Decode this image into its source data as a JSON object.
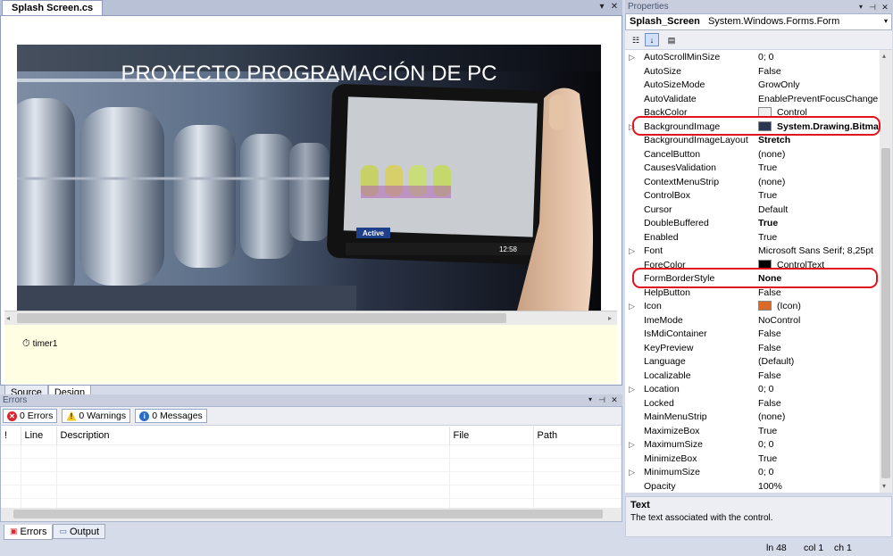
{
  "document_tab": {
    "title": "Splash Screen.cs"
  },
  "splash": {
    "title": "PROYECTO PROGRAMACIÓN DE PC",
    "tablet_status": "Active",
    "tablet_clock": "12:58"
  },
  "component_tray": {
    "timer": "timer1"
  },
  "designer_tabs": [
    "Source",
    "Design"
  ],
  "errors": {
    "title": "Errors",
    "errors_btn": "0 Errors",
    "warnings_btn": "0 Warnings",
    "messages_btn": "0 Messages",
    "columns": [
      "!",
      "Line",
      "Description",
      "File",
      "Path"
    ]
  },
  "bottom_tabs": [
    "Errors",
    "Output"
  ],
  "properties": {
    "title": "Properties",
    "object_name": "Splash_Screen",
    "object_type": "System.Windows.Forms.Form",
    "rows": [
      {
        "name": "AutoScrollMinSize",
        "value": "0; 0",
        "expandable": true,
        "bold": false
      },
      {
        "name": "AutoSize",
        "value": "False",
        "expandable": false,
        "bold": false
      },
      {
        "name": "AutoSizeMode",
        "value": "GrowOnly",
        "expandable": false,
        "bold": false
      },
      {
        "name": "AutoValidate",
        "value": "EnablePreventFocusChange",
        "expandable": false,
        "bold": false
      },
      {
        "name": "BackColor",
        "value": "Control",
        "expandable": false,
        "bold": false,
        "swatch": "#f0f0f0"
      },
      {
        "name": "BackgroundImage",
        "value": "System.Drawing.Bitmap",
        "expandable": true,
        "bold": true,
        "swatch": "#2a3550"
      },
      {
        "name": "BackgroundImageLayout",
        "value": "Stretch",
        "expandable": false,
        "bold": true
      },
      {
        "name": "CancelButton",
        "value": "(none)",
        "expandable": false,
        "bold": false
      },
      {
        "name": "CausesValidation",
        "value": "True",
        "expandable": false,
        "bold": false
      },
      {
        "name": "ContextMenuStrip",
        "value": "(none)",
        "expandable": false,
        "bold": false
      },
      {
        "name": "ControlBox",
        "value": "True",
        "expandable": false,
        "bold": false
      },
      {
        "name": "Cursor",
        "value": "Default",
        "expandable": false,
        "bold": false
      },
      {
        "name": "DoubleBuffered",
        "value": "True",
        "expandable": false,
        "bold": true
      },
      {
        "name": "Enabled",
        "value": "True",
        "expandable": false,
        "bold": false
      },
      {
        "name": "Font",
        "value": "Microsoft Sans Serif; 8,25pt",
        "expandable": true,
        "bold": false
      },
      {
        "name": "ForeColor",
        "value": "ControlText",
        "expandable": false,
        "bold": false,
        "swatch": "#000000"
      },
      {
        "name": "FormBorderStyle",
        "value": "None",
        "expandable": false,
        "bold": true
      },
      {
        "name": "HelpButton",
        "value": "False",
        "expandable": false,
        "bold": false
      },
      {
        "name": "Icon",
        "value": "(Icon)",
        "expandable": true,
        "bold": false,
        "swatch": "#d96b2a"
      },
      {
        "name": "ImeMode",
        "value": "NoControl",
        "expandable": false,
        "bold": false
      },
      {
        "name": "IsMdiContainer",
        "value": "False",
        "expandable": false,
        "bold": false
      },
      {
        "name": "KeyPreview",
        "value": "False",
        "expandable": false,
        "bold": false
      },
      {
        "name": "Language",
        "value": "(Default)",
        "expandable": false,
        "bold": false
      },
      {
        "name": "Localizable",
        "value": "False",
        "expandable": false,
        "bold": false
      },
      {
        "name": "Location",
        "value": "0; 0",
        "expandable": true,
        "bold": false
      },
      {
        "name": "Locked",
        "value": "False",
        "expandable": false,
        "bold": false
      },
      {
        "name": "MainMenuStrip",
        "value": "(none)",
        "expandable": false,
        "bold": false
      },
      {
        "name": "MaximizeBox",
        "value": "True",
        "expandable": false,
        "bold": false
      },
      {
        "name": "MaximumSize",
        "value": "0; 0",
        "expandable": true,
        "bold": false
      },
      {
        "name": "MinimizeBox",
        "value": "True",
        "expandable": false,
        "bold": false
      },
      {
        "name": "MinimumSize",
        "value": "0; 0",
        "expandable": true,
        "bold": false
      },
      {
        "name": "Opacity",
        "value": "100%",
        "expandable": false,
        "bold": false
      }
    ],
    "description_title": "Text",
    "description_text": "The text associated with the control."
  },
  "status": {
    "line": "ln 48",
    "col": "col 1",
    "ch": "ch 1"
  },
  "colors": {
    "highlight": "#e0141e",
    "accent": "#6d8fc5"
  }
}
